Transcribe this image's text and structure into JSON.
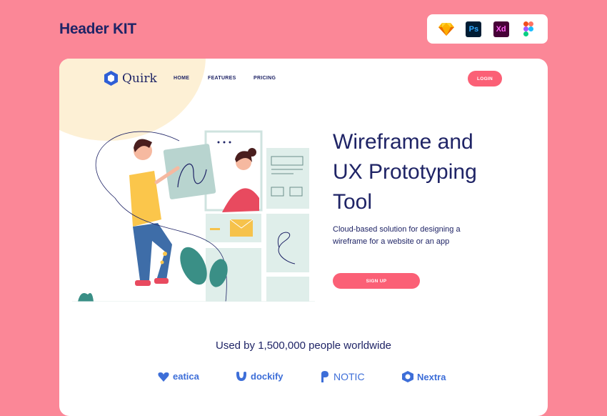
{
  "kit_title": "Header KIT",
  "tools": [
    {
      "name": "sketch-icon"
    },
    {
      "name": "photoshop-icon",
      "label": "Ps"
    },
    {
      "name": "xd-icon",
      "label": "Xd"
    },
    {
      "name": "figma-icon"
    }
  ],
  "nav": {
    "logo": "Quirk",
    "links": [
      "HOME",
      "FEATURES",
      "PRICING"
    ],
    "login": "LOGIN"
  },
  "hero": {
    "title_lines": [
      "Wireframe and",
      "UX Prototyping",
      "Tool"
    ],
    "subtitle_lines": [
      "Cloud-based solution for designing a",
      "wireframe for a website or an app"
    ],
    "cta": "SIGN UP"
  },
  "social_proof": {
    "text": "Used by 1,500,000 people worldwide",
    "brands": [
      "eatica",
      "dockify",
      "NOTIC",
      "Nextra"
    ]
  },
  "colors": {
    "background": "#fb8797",
    "accent": "#fb6076",
    "navy": "#1f2466",
    "brand_blue": "#3d6ed8"
  }
}
